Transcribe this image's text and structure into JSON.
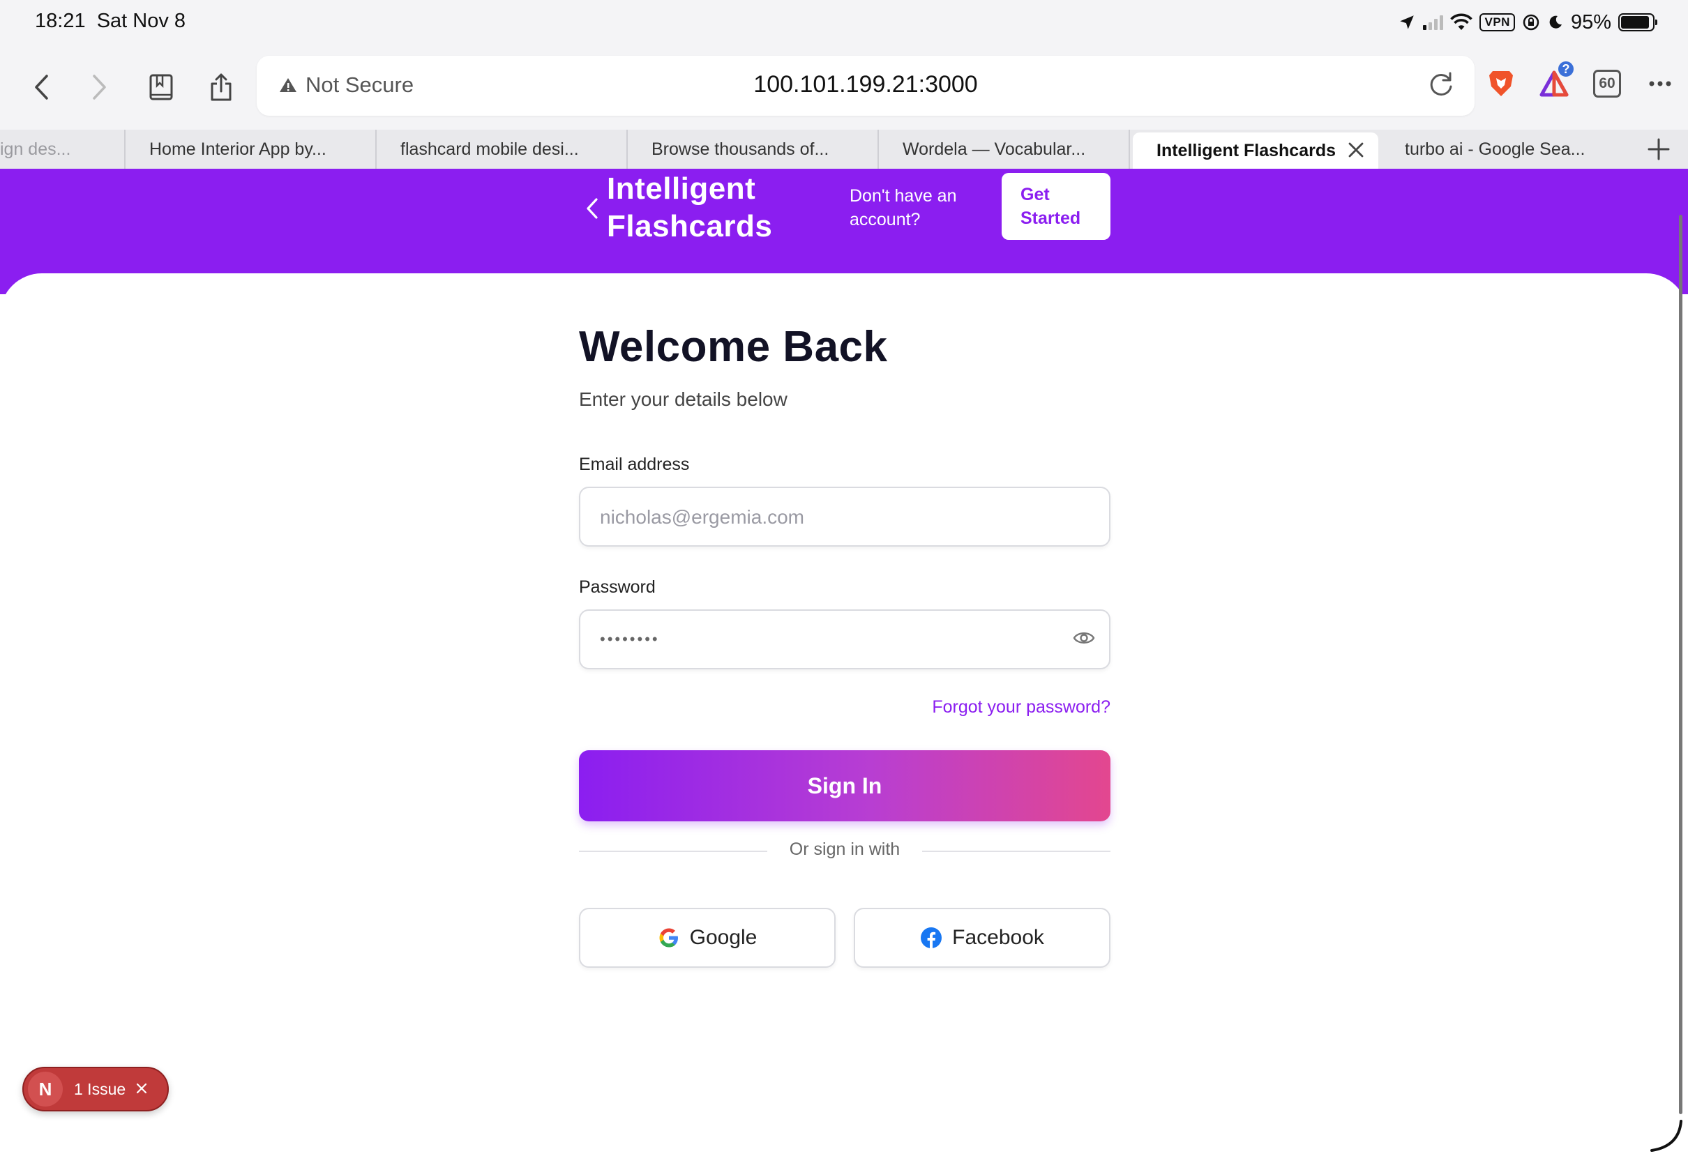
{
  "status_bar": {
    "time": "18:21",
    "date": "Sat Nov 8",
    "vpn_label": "VPN",
    "battery_percent": "95%"
  },
  "toolbar": {
    "security_label": "Not Secure",
    "url": "100.101.199.21:3000",
    "tab_count": "60",
    "extension_badge": "?"
  },
  "tabs": [
    {
      "label": "ign des..."
    },
    {
      "label": "Home Interior App by..."
    },
    {
      "label": "flashcard mobile desi..."
    },
    {
      "label": "Browse thousands of..."
    },
    {
      "label": "Wordela — Vocabular..."
    },
    {
      "label": "Intelligent Flashcards",
      "active": true
    },
    {
      "label": "turbo ai - Google Sea..."
    }
  ],
  "header": {
    "brand_line1": "Intelligent",
    "brand_line2": "Flashcards",
    "prompt_line1": "Don't have an",
    "prompt_line2": "account?",
    "cta_line1": "Get",
    "cta_line2": "Started"
  },
  "form": {
    "title": "Welcome Back",
    "subtitle": "Enter your details below",
    "email_label": "Email address",
    "email_placeholder": "nicholas@ergemia.com",
    "password_label": "Password",
    "password_value": "••••••••",
    "forgot_link": "Forgot your password?",
    "signin_label": "Sign In",
    "divider_text": "Or sign in with",
    "google_label": "Google",
    "facebook_label": "Facebook"
  },
  "dev_overlay": {
    "logo_letter": "N",
    "issue_text": "1 Issue"
  },
  "colors": {
    "brand_purple": "#8b1ef0",
    "gradient_end": "#e3478f",
    "issue_red": "#c03a3a"
  }
}
